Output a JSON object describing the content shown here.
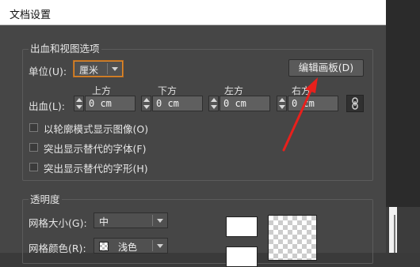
{
  "window": {
    "title": "文档设置"
  },
  "bleed_view": {
    "group_title": "出血和视图选项",
    "unit_label": "单位(U):",
    "unit_value": "厘米",
    "edit_artboards_button": "编辑画板(D)",
    "bleed_label": "出血(L):",
    "fields": [
      {
        "label": "上方",
        "value": "0 cm"
      },
      {
        "label": "下方",
        "value": "0 cm"
      },
      {
        "label": "左方",
        "value": "0 cm"
      },
      {
        "label": "右方",
        "value": "0 cm"
      }
    ],
    "checkboxes": [
      {
        "label": "以轮廓模式显示图像(O)",
        "checked": false
      },
      {
        "label": "突出显示替代的字体(F)",
        "checked": false
      },
      {
        "label": "突出显示替代的字形(H)",
        "checked": false
      }
    ]
  },
  "transparency": {
    "group_title": "透明度",
    "grid_size_label": "网格大小(G):",
    "grid_size_value": "中",
    "grid_color_label": "网格颜色(R):",
    "grid_color_value": "浅色"
  },
  "colors": {
    "accent_focus": "#e28a2b",
    "annotation_arrow": "#e8201c"
  },
  "icons": {
    "link": "link-chain-icon",
    "grid_color": "checkerboard-icon"
  }
}
